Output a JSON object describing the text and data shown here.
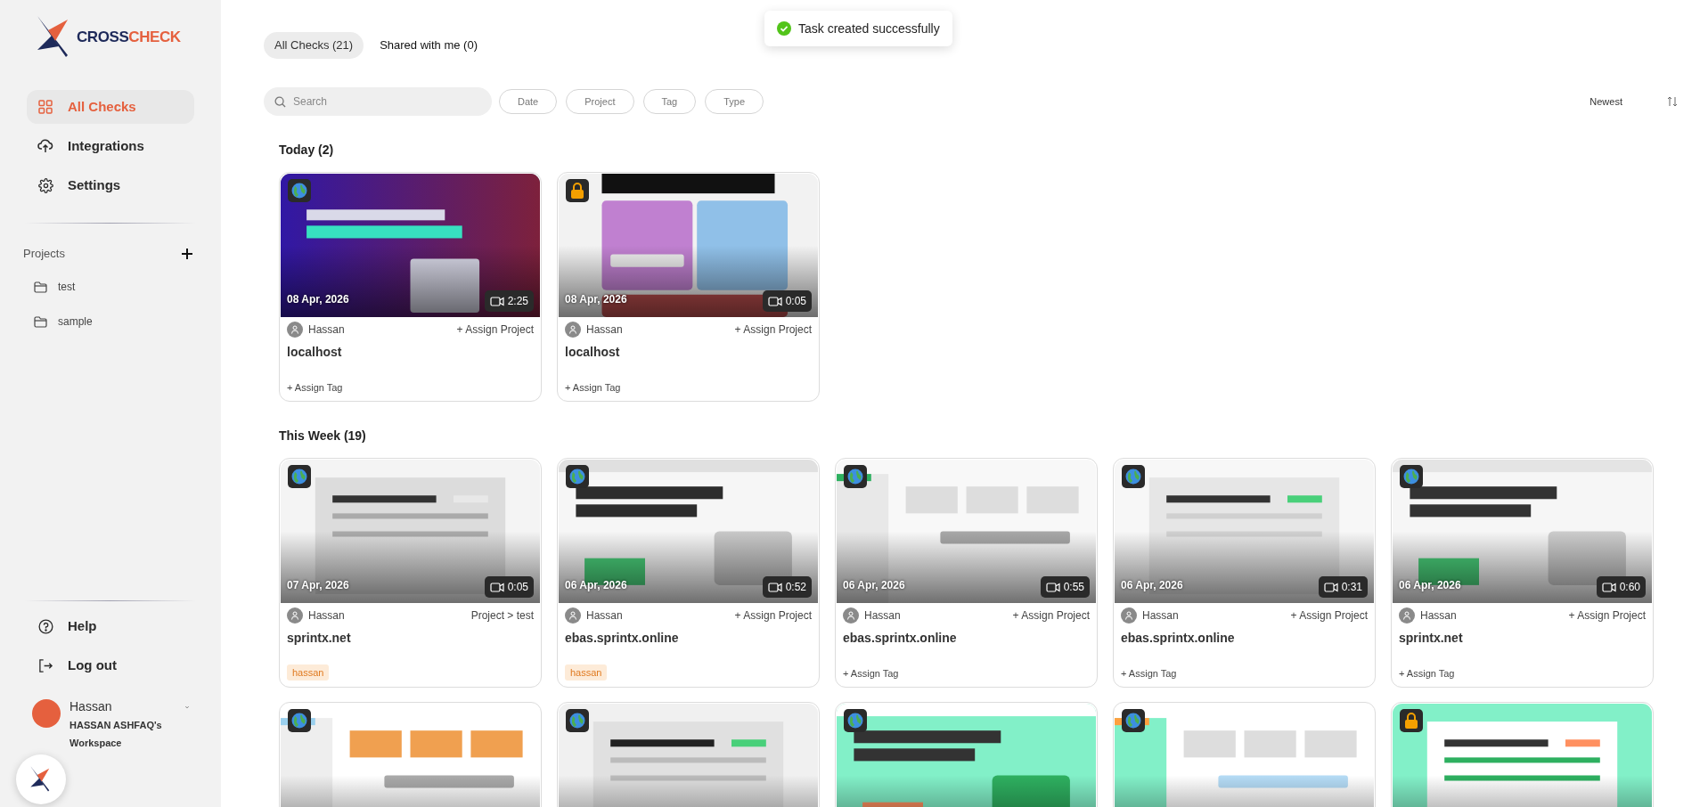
{
  "brand": {
    "part_1": "CROSS",
    "part_2": "CHECK"
  },
  "nav": [
    {
      "label": "All Checks",
      "selected": true
    },
    {
      "label": "Integrations",
      "selected": false
    },
    {
      "label": "Settings",
      "selected": false
    }
  ],
  "projects": {
    "title": "Projects",
    "items": [
      "test",
      "sample"
    ]
  },
  "footer_nav": [
    "Help",
    "Log out"
  ],
  "user": {
    "name": "Hassan",
    "workspace": "HASSAN ASHFAQ's Workspace"
  },
  "toast": "Task created successfully",
  "tabs": [
    {
      "label": "All Checks (21)",
      "selected": true
    },
    {
      "label": "Shared with me (0)",
      "selected": false
    }
  ],
  "search": {
    "placeholder": "Search"
  },
  "filters": [
    "Date",
    "Project",
    "Tag",
    "Type"
  ],
  "sort": "Newest",
  "sections": [
    {
      "title": "Today (2)",
      "cards": [
        {
          "locked": false,
          "date": "08 Apr, 2026",
          "duration": "2:25",
          "user": "Hassan",
          "project": "+ Assign Project",
          "title": "localhost",
          "tag_action": "+ Assign Tag"
        },
        {
          "locked": true,
          "date": "08 Apr, 2026",
          "duration": "0:05",
          "user": "Hassan",
          "project": "+ Assign Project",
          "title": "localhost",
          "tag_action": "+ Assign Tag"
        }
      ]
    },
    {
      "title": "This Week (19)",
      "cards": [
        {
          "locked": false,
          "date": "07 Apr, 2026",
          "duration": "0:05",
          "user": "Hassan",
          "project": "Project > test",
          "title": "sprintx.net",
          "tags": [
            "hassan"
          ]
        },
        {
          "locked": false,
          "date": "06 Apr, 2026",
          "duration": "0:52",
          "user": "Hassan",
          "project": "+ Assign Project",
          "title": "ebas.sprintx.online",
          "tags": [
            "hassan"
          ]
        },
        {
          "locked": false,
          "date": "06 Apr, 2026",
          "duration": "0:55",
          "user": "Hassan",
          "project": "+ Assign Project",
          "title": "ebas.sprintx.online",
          "tag_action": "+ Assign Tag"
        },
        {
          "locked": false,
          "date": "06 Apr, 2026",
          "duration": "0:31",
          "user": "Hassan",
          "project": "+ Assign Project",
          "title": "ebas.sprintx.online",
          "tag_action": "+ Assign Tag"
        },
        {
          "locked": false,
          "date": "06 Apr, 2026",
          "duration": "0:60",
          "user": "Hassan",
          "project": "+ Assign Project",
          "title": "sprintx.net",
          "tag_action": "+ Assign Tag"
        },
        {
          "locked": false
        },
        {
          "locked": false
        },
        {
          "locked": false
        },
        {
          "locked": false
        },
        {
          "locked": true
        }
      ]
    }
  ]
}
